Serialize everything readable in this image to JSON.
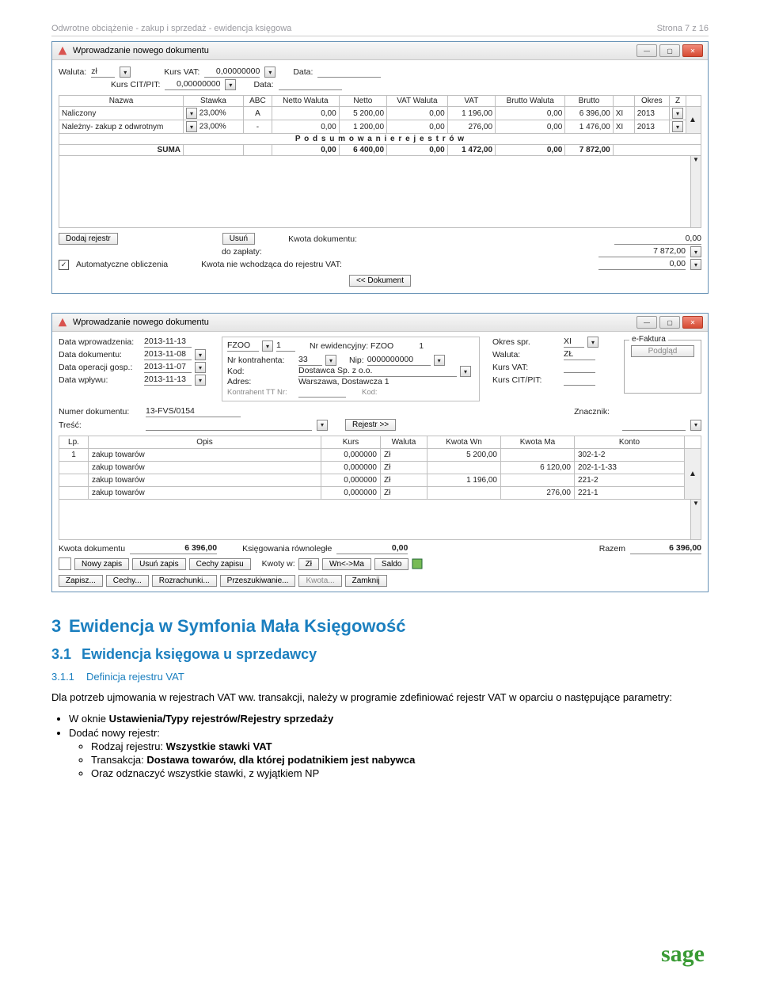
{
  "header": {
    "title": "Odwrotne obciążenie - zakup i sprzedaż - ewidencja księgowa",
    "page": "Strona 7 z 16"
  },
  "win1": {
    "title": "Wprowadzanie nowego dokumentu",
    "walutaLbl": "Waluta:",
    "waluta": "zł",
    "kursVatLbl": "Kurs VAT:",
    "kursVat": "0,00000000",
    "dataLbl": "Data:",
    "kursCitLbl": "Kurs CIT/PIT:",
    "kursCit": "0,00000000",
    "cols": [
      "Nazwa",
      "Stawka",
      "ABC",
      "Netto Waluta",
      "Netto",
      "VAT Waluta",
      "VAT",
      "Brutto Waluta",
      "Brutto",
      "",
      "Okres",
      "Z"
    ],
    "rows": [
      {
        "nazwa": "Naliczony",
        "stawka": "23,00%",
        "abc": "A",
        "nw": "0,00",
        "netto": "5 200,00",
        "vw": "0,00",
        "vat": "1 196,00",
        "bw": "0,00",
        "brutto": "6 396,00",
        "m": "XI",
        "okres": "2013"
      },
      {
        "nazwa": "Należny- zakup z odwrotnym",
        "stawka": "23,00%",
        "abc": "-",
        "nw": "0,00",
        "netto": "1 200,00",
        "vw": "0,00",
        "vat": "276,00",
        "bw": "0,00",
        "brutto": "1 476,00",
        "m": "XI",
        "okres": "2013"
      }
    ],
    "sumTitle": "P o d s u m o w a n i e    r e j e s t r ó w",
    "sumLbl": "SUMA",
    "sum": {
      "nw": "0,00",
      "netto": "6 400,00",
      "vw": "0,00",
      "vat": "1 472,00",
      "bw": "0,00",
      "brutto": "7 872,00"
    },
    "btnDodaj": "Dodaj rejestr",
    "btnUsun": "Usuń",
    "kwotaDokLbl": "Kwota dokumentu:",
    "kwotaDok": "0,00",
    "doZaplatyLbl": "do zapłaty:",
    "doZaplaty": "7 872,00",
    "autoLbl": "Automatyczne obliczenia",
    "auto": true,
    "kwotaNieLbl": "Kwota nie wchodząca do rejestru VAT:",
    "kwotaNie": "0,00",
    "backBtn": "<< Dokument"
  },
  "win2": {
    "title": "Wprowadzanie nowego dokumentu",
    "left": {
      "l1": "Data wprowadzenia:",
      "v1": "2013-11-13",
      "l2": "Data dokumentu:",
      "v2": "2013-11-08",
      "l3": "Data operacji gosp.:",
      "v3": "2013-11-07",
      "l4": "Data wpływu:",
      "v4": "2013-11-13",
      "lnum": "Numer dokumentu:",
      "vnum": "13-FVS/0154",
      "ltresc": "Treść:"
    },
    "mid": {
      "typ": "FZOO",
      "lp": "1",
      "nrEwLbl": "Nr ewidencyjny: FZOO",
      "nrEw": "1",
      "kontrLbl": "Nr kontrahenta:",
      "kontrNr": "33",
      "nipLbl": "Nip:",
      "nip": "0000000000",
      "kodLbl": "Kod:",
      "kod": "Dostawca Sp. z o.o.",
      "adrLbl": "Adres:",
      "adr": "Warszawa, Dostawcza 1",
      "kttLbl": "Kontrahent TT Nr:",
      "kodLbl2": "Kod:",
      "rejBtn": "Rejestr >>"
    },
    "right": {
      "okresLbl": "Okres spr.",
      "okres": "XI",
      "walutaLbl": "Waluta:",
      "waluta": "ZŁ",
      "kursVatLbl": "Kurs VAT:",
      "kursCitLbl": "Kurs CIT/PIT:",
      "znacznikLbl": "Znacznik:",
      ".puste": ".puste",
      "efaktura": "e-Faktura",
      "podglad": "Podgląd"
    },
    "accCols": [
      "Lp.",
      "Opis",
      "Kurs",
      "Waluta",
      "Kwota Wn",
      "Kwota Ma",
      "Konto"
    ],
    "accRows": [
      {
        "lp": "1",
        "opis": "zakup towarów",
        "kurs": "0,000000",
        "wal": "Zł",
        "wn": "5 200,00",
        "ma": "",
        "konto": "302-1-2"
      },
      {
        "lp": "",
        "opis": "zakup towarów",
        "kurs": "0,000000",
        "wal": "Zł",
        "wn": "",
        "ma": "6 120,00",
        "konto": "202-1-1-33"
      },
      {
        "lp": "",
        "opis": "zakup towarów",
        "kurs": "0,000000",
        "wal": "Zł",
        "wn": "1 196,00",
        "ma": "",
        "konto": "221-2"
      },
      {
        "lp": "",
        "opis": "zakup towarów",
        "kurs": "0,000000",
        "wal": "Zł",
        "wn": "",
        "ma": "276,00",
        "konto": "221-1"
      }
    ],
    "foot": {
      "kwDokLbl": "Kwota dokumentu",
      "kwDok": "6 396,00",
      "ksRownLbl": "Księgowania równoległe",
      "ksRown": "0,00",
      "razemLbl": "Razem",
      "razem": "6 396,00",
      "nowy": "Nowy zapis",
      "usun": "Usuń zapis",
      "cechy": "Cechy zapisu",
      "kwotyW": "Kwoty w:",
      "zl": "Zł",
      "wnma": "Wn<->Ma",
      "saldo": "Saldo"
    },
    "bottom": [
      "Zapisz...",
      "Cechy...",
      "Rozrachunki...",
      "Przeszukiwanie...",
      "Kwota...",
      "Zamknij"
    ]
  },
  "text": {
    "h1num": "3",
    "h1": "Ewidencja w Symfonia Mała Księgowość",
    "h2num": "3.1",
    "h2": "Ewidencja księgowa u sprzedawcy",
    "h3num": "3.1.1",
    "h3": "Definicja rejestru VAT",
    "p": "Dla potrzeb ujmowania w rejestrach VAT ww. transakcji, należy w programie zdefiniować rejestr VAT w oparciu o następujące parametry:",
    "b1": "W oknie ",
    "b1b": "Ustawienia/Typy rejestrów/Rejestry sprzedaży",
    "b2": "Dodać nowy rejestr:",
    "c1": "Rodzaj rejestru: ",
    "c1b": "Wszystkie stawki VAT",
    "c2": "Transakcja: ",
    "c2b": "Dostawa towarów, dla której podatnikiem jest nabywca",
    "c3": "Oraz odznaczyć wszystkie stawki, z wyjątkiem NP"
  }
}
